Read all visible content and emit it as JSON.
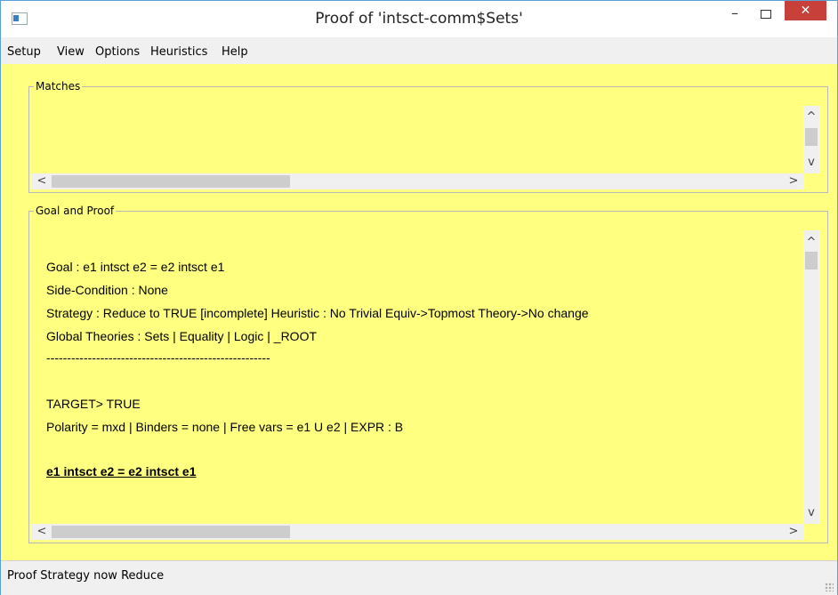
{
  "window": {
    "title": "Proof of 'intsct-comm$Sets'",
    "controls": {
      "minimize": "–",
      "close": "✕"
    }
  },
  "menu": [
    "Setup",
    "View",
    "Options",
    "Heuristics",
    "Help"
  ],
  "matches": {
    "label": "Matches",
    "arrows": {
      "up": "^",
      "down": "v",
      "left": "<",
      "right": ">"
    }
  },
  "goal_proof": {
    "label": "Goal and Proof",
    "lines": {
      "goal": "Goal : e1 intsct e2 = e2 intsct e1",
      "side_condition": "Side-Condition : None",
      "strategy": "Strategy : Reduce to TRUE [incomplete]  Heuristic : No Trivial Equiv->Topmost Theory->No change",
      "global_theories": "Global Theories : Sets | Equality | Logic | _ROOT",
      "separator": "------------------------------------------------------",
      "target": "TARGET> TRUE",
      "polarity": "Polarity = mxd | Binders = none | Free vars = e1 U e2 | EXPR : B",
      "expression": "e1 intsct e2 = e2 intsct e1"
    },
    "arrows": {
      "up": "^",
      "down": "v",
      "left": "<",
      "right": ">"
    }
  },
  "status": "Proof Strategy now Reduce"
}
